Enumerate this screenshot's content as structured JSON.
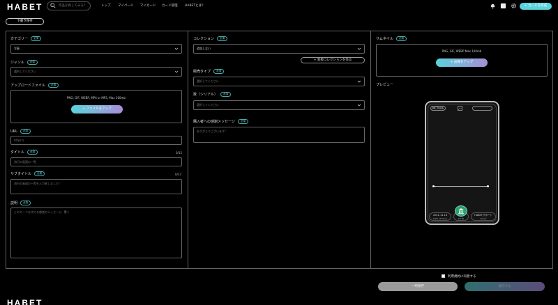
{
  "header": {
    "logo": "HABET",
    "search_placeholder": "作品を探してみる？",
    "nav": [
      "トップ",
      "マイページ",
      "マイカード",
      "カード管理",
      "HABETとは？"
    ],
    "create_button": "+ カードを作成",
    "icons": [
      "bell-icon",
      "square-icon",
      "gear-icon"
    ]
  },
  "draft_button": "下書き保存",
  "required": "必須",
  "left": {
    "category_label": "カテゴリー",
    "category_value": "写真",
    "genre_label": "ジャンル",
    "genre_placeholder": "選択してください",
    "upload_label": "アップロードファイル",
    "upload_formats": "PNG, GIF, WEBP, MP4 or MP3, Max 100mb",
    "upload_button": "+ ファイルをアップ",
    "url_label": "URL",
    "url_placeholder": "https://",
    "title_label": "タイトル",
    "title_count": "0/15",
    "title_placeholder": "流行の画面の一覧",
    "subtitle_label": "サブタイトル",
    "subtitle_count": "0/37",
    "subtitle_placeholder": "流行の画面の一覧を入力致しました！",
    "desc_label": "説明",
    "desc_placeholder": "このカードを持てる感覚のメッセージ、驚く"
  },
  "middle": {
    "collection_label": "コレクション",
    "collection_value": "追加しない",
    "new_collection_button": "+ 新規コレクションを作る",
    "sale_type_label": "販売タイプ",
    "sale_type_placeholder": "選択してください",
    "quantity_label": "数（シリアル）",
    "quantity_placeholder": "選択してください",
    "thanks_label": "購入者への感謝メッセージ",
    "thanks_placeholder": "ありがとうございます！"
  },
  "right": {
    "thumbnail_label": "サムネイル",
    "thumbnail_formats": "PNG, GIF, WEBP Max 100mb",
    "thumbnail_button": "+ 画像をアップ",
    "preview_label": "プレビュー",
    "preview_type": "PICTURE",
    "preview_date": "2021.11.16",
    "preview_date_label": "Date of Issue",
    "preview_owner": "HABETサポート",
    "preview_owner_label": "Issuer",
    "preview_center_label": "Serial"
  },
  "footer": {
    "agree_text": "利用規約に同意する",
    "save_button": "一時保存",
    "publish_button": "発行する",
    "bottom_logo": "HABET"
  },
  "colors": {
    "accent": "#5bd3dc",
    "accent2": "#a88ed8",
    "required": "#4aa"
  }
}
